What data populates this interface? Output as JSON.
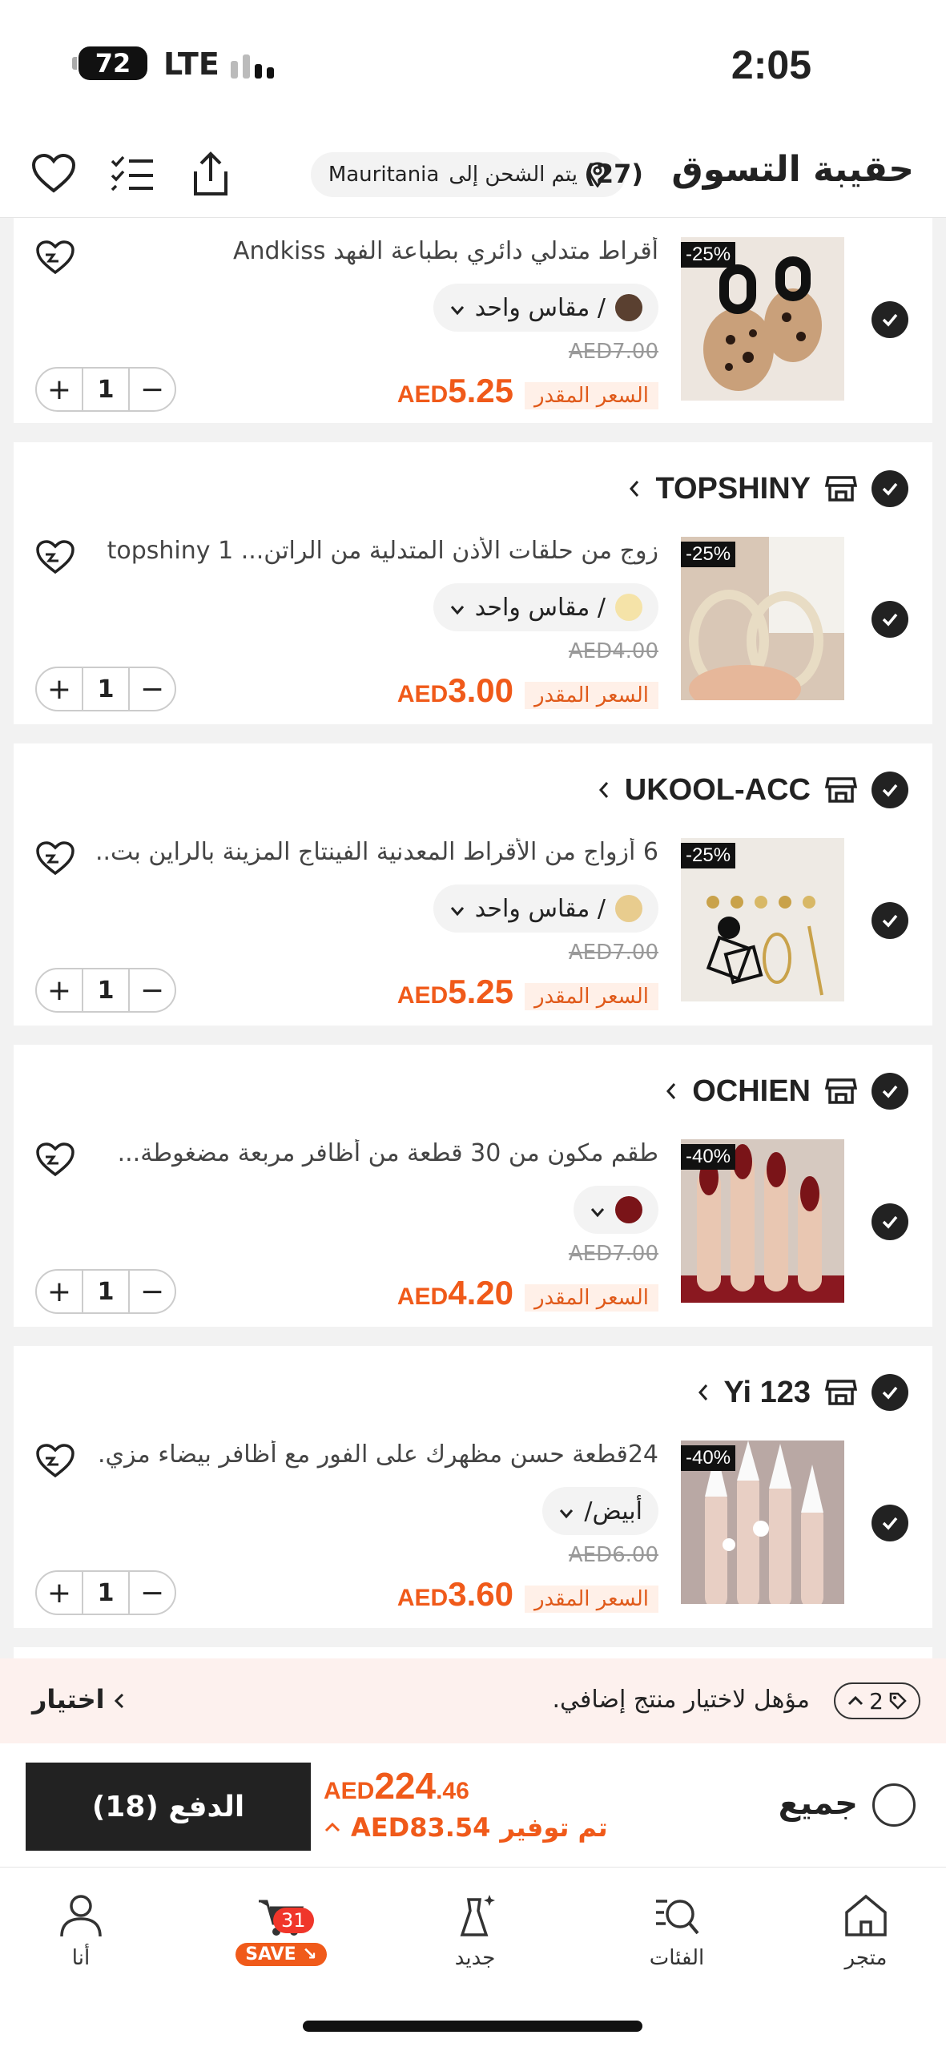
{
  "status_bar": {
    "battery": "72",
    "network": "LTE",
    "time": "2:05"
  },
  "header": {
    "title": "حقيبة التسوق",
    "count": "(27)",
    "ship_label": "يتم الشحن إلى",
    "ship_country": "Mauritania"
  },
  "stores": [
    "TOPSHINY",
    "UKOOL-ACC",
    "OCHIEN",
    "Yi 123"
  ],
  "items": [
    {
      "name": "أقراط متدلي دائري بطباعة الفهد Andkiss",
      "variant": "/ مقاس واحد",
      "swatch": "#5a4030",
      "discount": "-25%",
      "orig": "AED7.00",
      "cur": "AED",
      "price": "5.25",
      "qty": "1"
    },
    {
      "name": "زوج من حلقات الأذن المتدلية من الراتن... topshiny 1",
      "variant": "/ مقاس واحد",
      "swatch": "#f5e3a8",
      "discount": "-25%",
      "orig": "AED4.00",
      "cur": "AED",
      "price": "3.00",
      "qty": "1"
    },
    {
      "name": "6 أزواج من الأقراط المعدنية الفينتاج المزينة بالراين بت...",
      "variant": "/ مقاس واحد",
      "swatch": "#e8cc8e",
      "discount": "-25%",
      "orig": "AED7.00",
      "cur": "AED",
      "price": "5.25",
      "qty": "1"
    },
    {
      "name": "طقم مكون من 30 قطعة من أظافر مربعة مضغوطة...",
      "variant": "",
      "swatch": "#7a1418",
      "discount": "-40%",
      "orig": "AED7.00",
      "cur": "AED",
      "price": "4.20",
      "qty": "1"
    },
    {
      "name": "24قطعة حسن مظهرك على الفور مع أظافر بيضاء مزي...",
      "variant": "أبيض/",
      "swatch": "",
      "discount": "-40%",
      "orig": "AED6.00",
      "cur": "AED",
      "price": "3.60",
      "qty": "1"
    }
  ],
  "est_label": "السعر المقدر",
  "promo": {
    "count": "2",
    "text": "مؤهل لاختيار منتج إضافي.",
    "action": "اختيار"
  },
  "checkout": {
    "all_label": "جميع",
    "total_cur": "AED",
    "total_int": "224",
    "total_dec": ".46",
    "saved_label": "تم توفير",
    "saved_amount": "AED83.54",
    "pay_label": "الدفع (18)"
  },
  "nav": {
    "shop": "متجر",
    "categories": "الفئات",
    "new": "جديد",
    "cart_badge": "31",
    "save": "SAVE",
    "me": "أنا"
  }
}
